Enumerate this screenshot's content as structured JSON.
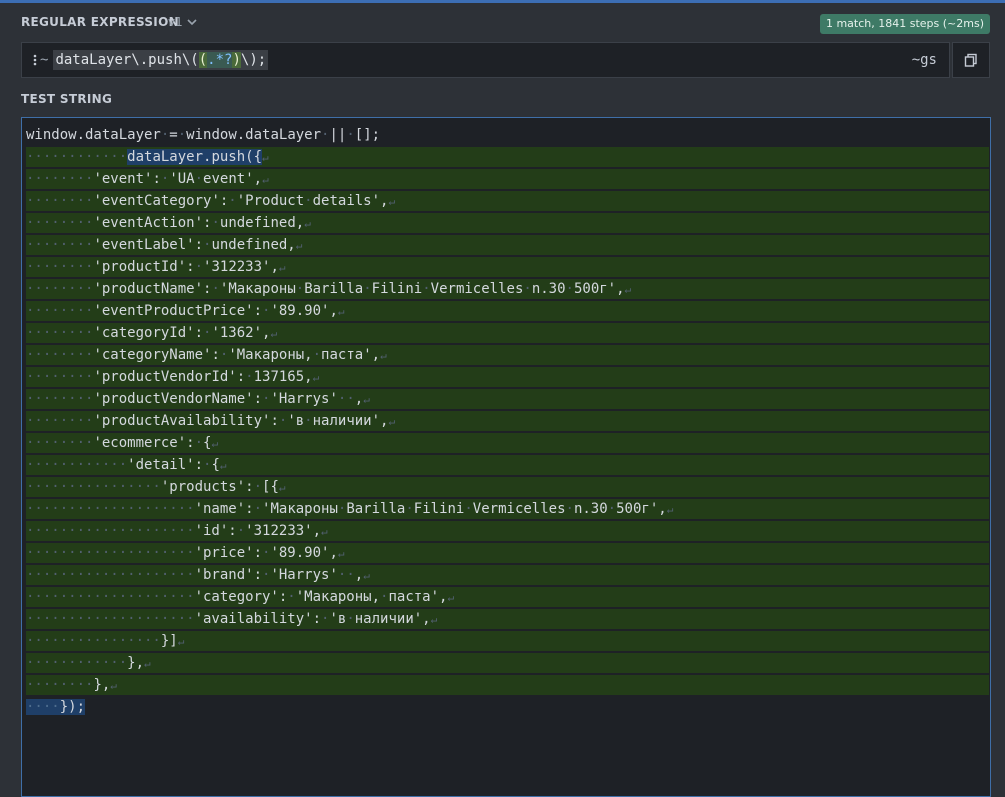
{
  "regex_section": {
    "title": "REGULAR EXPRESSION",
    "version": "v1",
    "match_info": "1 match, 1841 steps (~2ms)",
    "delimiter": "~",
    "pattern_prefix": "dataLayer\\.push\\(",
    "pattern_group_open": "(",
    "pattern_group_inner": ".*?",
    "pattern_group_close": ")",
    "pattern_suffix": "\\);",
    "flags": "~gs"
  },
  "test_section": {
    "title": "TEST STRING",
    "lines": [
      {
        "indent": 0,
        "text": "window.dataLayer = window.dataLayer || [];",
        "hl": false,
        "nl": false
      },
      {
        "indent": 12,
        "text": "dataLayer.push({",
        "hl": true,
        "nl": true,
        "sel": true
      },
      {
        "indent": 8,
        "text": "'event': 'UA event',",
        "hl": true,
        "nl": true
      },
      {
        "indent": 8,
        "text": "'eventCategory': 'Product details',",
        "hl": true,
        "nl": true
      },
      {
        "indent": 8,
        "text": "'eventAction': undefined,",
        "hl": true,
        "nl": true
      },
      {
        "indent": 8,
        "text": "'eventLabel': undefined,",
        "hl": true,
        "nl": true
      },
      {
        "indent": 8,
        "text": "'productId': '312233',",
        "hl": true,
        "nl": true
      },
      {
        "indent": 8,
        "text": "'productName': 'Макароны Barilla Filini Vermicelles n.30 500г',",
        "hl": true,
        "nl": true
      },
      {
        "indent": 8,
        "text": "'eventProductPrice': '89.90',",
        "hl": true,
        "nl": true
      },
      {
        "indent": 8,
        "text": "'categoryId': '1362',",
        "hl": true,
        "nl": true
      },
      {
        "indent": 8,
        "text": "'categoryName': 'Макароны, паста',",
        "hl": true,
        "nl": true
      },
      {
        "indent": 8,
        "text": "'productVendorId': 137165,",
        "hl": true,
        "nl": true
      },
      {
        "indent": 8,
        "text": "'productVendorName': 'Harrys'  ,",
        "hl": true,
        "nl": true
      },
      {
        "indent": 8,
        "text": "'productAvailability': 'в наличии',",
        "hl": true,
        "nl": true
      },
      {
        "indent": 8,
        "text": "'ecommerce': {",
        "hl": true,
        "nl": true
      },
      {
        "indent": 12,
        "text": "'detail': {",
        "hl": true,
        "nl": true
      },
      {
        "indent": 16,
        "text": "'products': [{",
        "hl": true,
        "nl": true
      },
      {
        "indent": 20,
        "text": "'name': 'Макароны Barilla Filini Vermicelles n.30 500г',",
        "hl": true,
        "nl": true
      },
      {
        "indent": 20,
        "text": "'id': '312233',",
        "hl": true,
        "nl": true
      },
      {
        "indent": 20,
        "text": "'price': '89.90',",
        "hl": true,
        "nl": true
      },
      {
        "indent": 20,
        "text": "'brand': 'Harrys'  ,",
        "hl": true,
        "nl": true
      },
      {
        "indent": 20,
        "text": "'category': 'Макароны, паста',",
        "hl": true,
        "nl": true
      },
      {
        "indent": 20,
        "text": "'availability': 'в наличии',",
        "hl": true,
        "nl": true
      },
      {
        "indent": 16,
        "text": "}]",
        "hl": true,
        "nl": true
      },
      {
        "indent": 12,
        "text": "},",
        "hl": true,
        "nl": true
      },
      {
        "indent": 8,
        "text": "},",
        "hl": true,
        "nl": true
      },
      {
        "indent": 4,
        "text": "});",
        "hl": false,
        "nl": false,
        "sel_partial": true
      }
    ]
  },
  "colors": {
    "match_bg": "#233d18",
    "selection_bg": "#1f3f68",
    "badge_bg": "#3e7a66",
    "editor_border": "#3f6fa8"
  },
  "icons": {
    "version_dropdown": "chevron-down-icon",
    "copy": "copy-icon",
    "delimiter_menu": "kebab-icon"
  }
}
